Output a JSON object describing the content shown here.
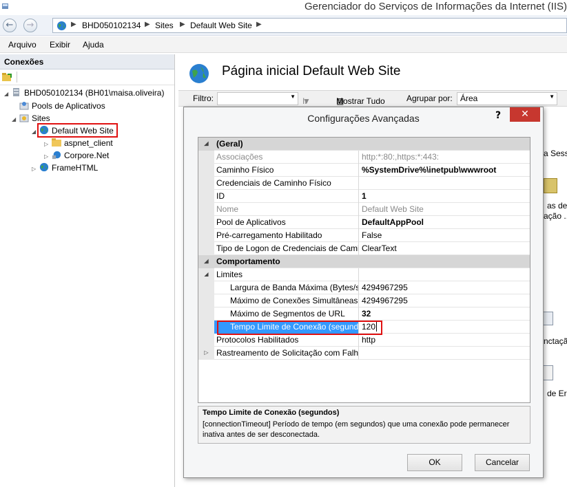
{
  "window": {
    "title": "Gerenciador do Serviços de Informações da Internet (IIS)"
  },
  "address": {
    "crumbs": [
      "BHD050102134",
      "Sites",
      "Default Web Site"
    ]
  },
  "menu": [
    "Arquivo",
    "Exibir",
    "Ajuda"
  ],
  "connections": {
    "header": "Conexões",
    "tree": [
      {
        "label": "BHD050102134 (BH01\\maisa.oliveira)",
        "icon": "server-icon"
      },
      {
        "label": "Pools de Aplicativos",
        "icon": "app-pool-icon"
      },
      {
        "label": "Sites",
        "icon": "sites-folder-icon"
      },
      {
        "label": "Default Web Site",
        "icon": "globe-icon"
      },
      {
        "label": "aspnet_client",
        "icon": "folder-icon"
      },
      {
        "label": "Corpore.Net",
        "icon": "web-app-icon"
      },
      {
        "label": "FrameHTML",
        "icon": "globe-icon"
      }
    ]
  },
  "main": {
    "title": "Página inicial Default Web Site",
    "filter_label": "Filtro:",
    "go_label": "Ir",
    "show_all": "Mostrar Tudo",
    "group_by_label": "Agrupar por:",
    "group_by_value": "Área",
    "peek": [
      "a Sessã",
      "as de",
      "ação ...",
      "nctaçã",
      "de Err"
    ]
  },
  "dialog": {
    "title": "Configurações Avançadas",
    "help": "?",
    "rows": [
      {
        "name": "(Geral)",
        "value": ""
      },
      {
        "name": "Associações",
        "value": "http:*:80:,https:*:443:"
      },
      {
        "name": "Caminho Físico",
        "value": "%SystemDrive%\\inetpub\\wwwroot"
      },
      {
        "name": "Credenciais de Caminho Físico",
        "value": ""
      },
      {
        "name": "ID",
        "value": "1"
      },
      {
        "name": "Nome",
        "value": "Default Web Site"
      },
      {
        "name": "Pool de Aplicativos",
        "value": "DefaultAppPool"
      },
      {
        "name": "Pré-carregamento Habilitado",
        "value": "False"
      },
      {
        "name": "Tipo de Logon de Credenciais de Camin",
        "value": "ClearText"
      },
      {
        "name": "Comportamento",
        "value": ""
      },
      {
        "name": "Limites",
        "value": ""
      },
      {
        "name": "Largura de Banda Máxima (Bytes/se",
        "value": "4294967295"
      },
      {
        "name": "Máximo de Conexões Simultâneas",
        "value": "4294967295"
      },
      {
        "name": "Máximo de Segmentos de URL",
        "value": "32"
      },
      {
        "name": "Tempo Limite de Conexão (segund",
        "value": "120"
      },
      {
        "name": "Protocolos Habilitados",
        "value": "http"
      },
      {
        "name": "Rastreamento de Solicitação com Falha",
        "value": ""
      }
    ],
    "description": {
      "title": "Tempo Limite de Conexão (segundos)",
      "text": "[connectionTimeout] Período de tempo (em segundos) que uma conexão pode permanecer inativa antes de ser desconectada."
    },
    "ok": "OK",
    "cancel": "Cancelar"
  },
  "colors": {
    "selection": "#3399ff",
    "highlight_box": "#e01010",
    "close_button": "#c7372f"
  }
}
